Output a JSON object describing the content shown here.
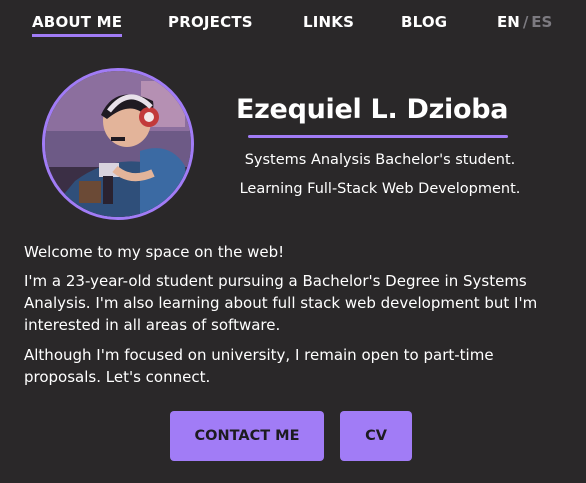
{
  "nav": {
    "items": [
      {
        "label": "ABOUT ME"
      },
      {
        "label": "PROJECTS"
      },
      {
        "label": "LINKS"
      },
      {
        "label": "BLOG"
      }
    ],
    "lang_active": "EN",
    "lang_separator": "/",
    "lang_inactive": "ES"
  },
  "profile": {
    "name": "Ezequiel L. Dzioba",
    "subtitle_1": "Systems Analysis Bachelor's student.",
    "subtitle_2": "Learning Full-Stack Web Development."
  },
  "about": {
    "welcome": "Welcome to my space on the web!",
    "p1": "I'm a 23-year-old student pursuing a Bachelor's Degree in Systems Analysis. I'm also learning about full stack web development but I'm interested in all areas of software.",
    "p2": "Although I'm focused on university, I remain open to part-time proposals. Let's connect."
  },
  "buttons": {
    "contact_label": "CONTACT ME",
    "cv_label": "CV"
  },
  "colors": {
    "accent": "#a17cf6",
    "background": "#2a2829",
    "text": "#ffffff",
    "muted": "#7c7a80"
  }
}
